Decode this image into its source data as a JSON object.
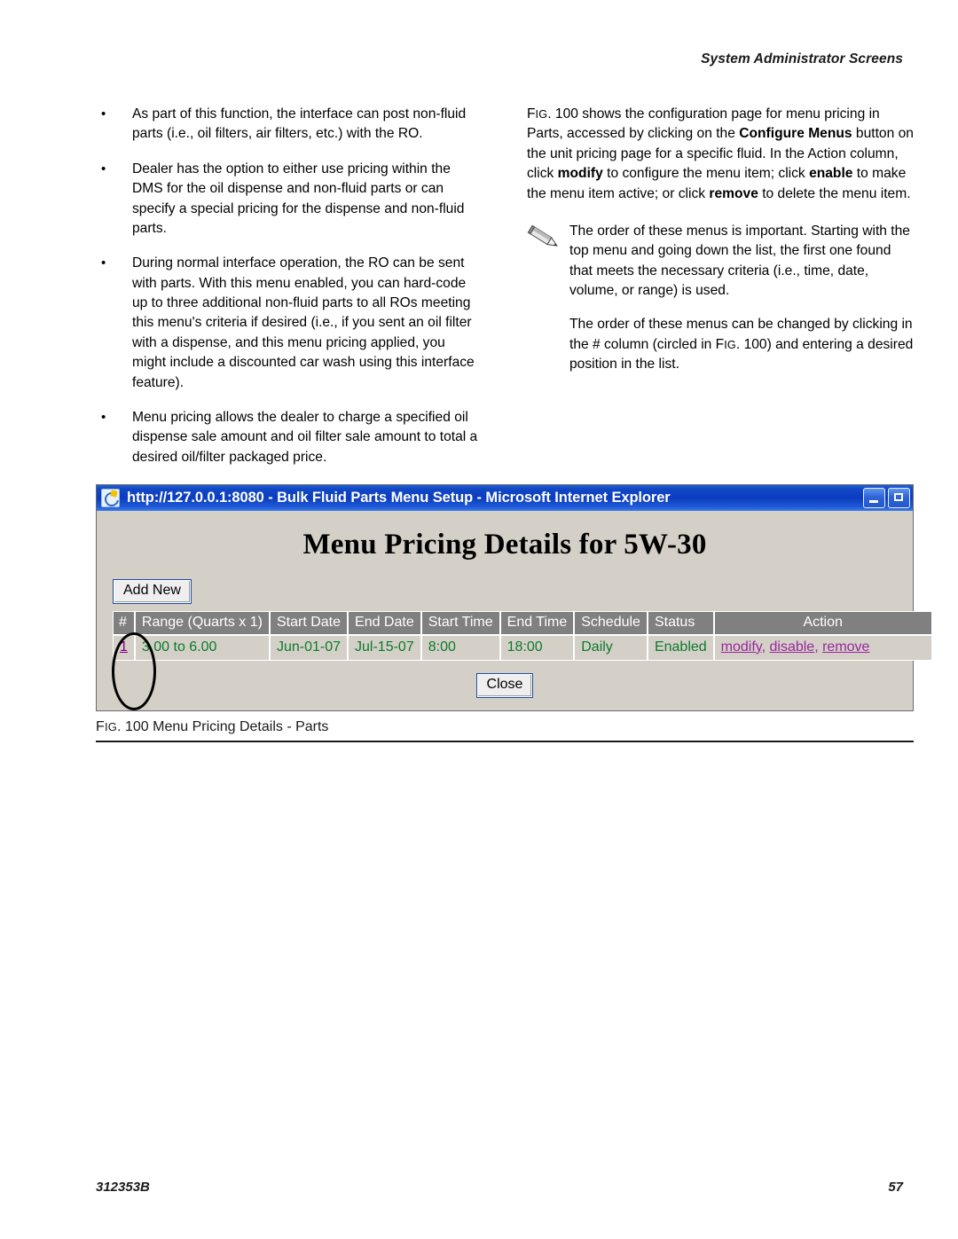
{
  "header": {
    "running_head": "System Administrator Screens"
  },
  "left_column": {
    "bullets": [
      "As part of this function, the interface can post non-fluid parts (i.e., oil filters, air filters, etc.) with the RO.",
      "Dealer has the option to either use pricing within the DMS for the oil dispense and non-fluid parts or can specify a special pricing for the dispense and non-fluid parts.",
      "During normal interface operation, the RO can be sent with parts. With this menu enabled, you can hard-code up to three additional non-fluid parts to all ROs meeting this menu's criteria if desired (i.e., if you sent an oil filter with a dispense, and this menu pricing applied, you might include a discounted car wash using this interface feature).",
      "Menu pricing allows the dealer to charge a specified oil dispense sale amount and oil filter sale amount to total a desired oil/filter packaged price."
    ],
    "bullet_glyph": "•"
  },
  "right_column": {
    "intro": {
      "p1_a": "F",
      "p1_b": "IG",
      "p1_c": ". 100 shows the configuration page for menu pricing in Parts, accessed by clicking on the ",
      "bold1": "Configure Menus",
      "p1_d": " button on the unit pricing page for a specific fluid. In the Action column, click ",
      "bold2": "modify",
      "p1_e": " to configure the menu item; click ",
      "bold3": "enable",
      "p1_f": " to make the menu item active; or click ",
      "bold4": "remove",
      "p1_g": " to delete the menu item."
    },
    "note": {
      "icon": "pencil-icon",
      "p1": "The order of these menus is important. Starting with the top menu and going down the list, the first one found that meets the necessary criteria (i.e., time, date, volume, or range) is used.",
      "p2_a": "The order of these menus can be changed by clicking in the # column (circled in ",
      "p2_fig": "F",
      "p2_fig_small": "IG",
      "p2_b": ". 100) and entering a desired position in the list."
    }
  },
  "figure": {
    "window": {
      "title": "http://127.0.0.1:8080 - Bulk Fluid Parts Menu Setup - Microsoft Internet Explorer",
      "icon": "internet-explorer-icon",
      "minimize_label": "Minimize",
      "restore_label": "Restore"
    },
    "page": {
      "heading": "Menu Pricing Details for 5W-30",
      "add_new_label": "Add New",
      "close_label": "Close"
    },
    "table": {
      "columns": [
        "#",
        "Range (Quarts x 1)",
        "Start Date",
        "End Date",
        "Start Time",
        "End Time",
        "Schedule",
        "Status",
        "Action"
      ],
      "rows": [
        {
          "num": "1",
          "range": "3.00 to 6.00",
          "start_date": "Jun-01-07",
          "end_date": "Jul-15-07",
          "start_time": "8:00",
          "end_time": "18:00",
          "schedule": "Daily",
          "status": "Enabled",
          "actions": [
            "modify",
            "disable",
            "remove"
          ],
          "action_text": "modify, disable, remove"
        }
      ]
    },
    "caption": {
      "prefix_cap": "F",
      "prefix_small": "IG",
      "text": ". 100 Menu Pricing Details - Parts"
    },
    "annotation": "circled-hash-column"
  },
  "footer": {
    "document_number": "312353B",
    "page_number": "57"
  },
  "colors": {
    "titlebar_blue": "#0b3cc0",
    "window_face": "#d4d0c8",
    "table_header_gray": "#808080",
    "data_green": "#0a7a2a",
    "link_purple": "#99269e"
  }
}
